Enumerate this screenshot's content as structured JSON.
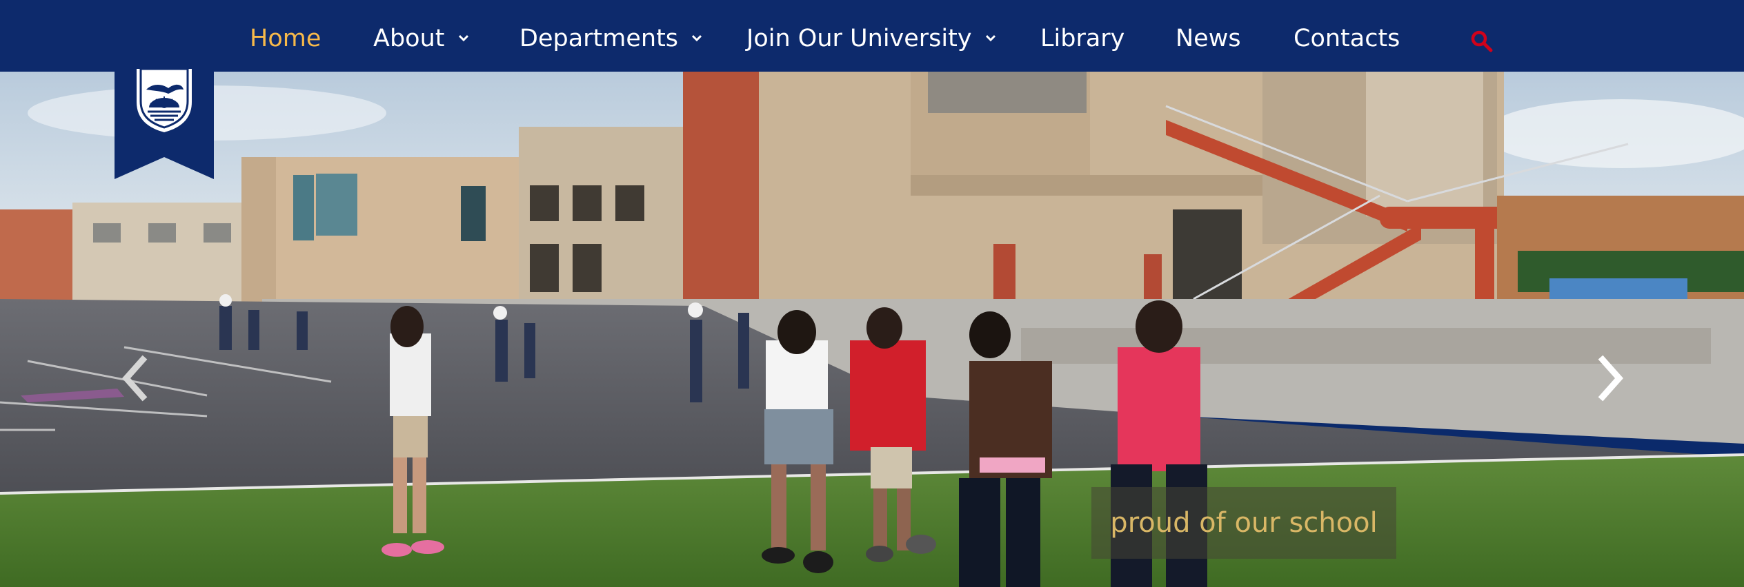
{
  "nav": {
    "items": [
      {
        "label": "Home",
        "active": true,
        "has_dropdown": false
      },
      {
        "label": "About",
        "active": false,
        "has_dropdown": true
      },
      {
        "label": "Departments",
        "active": false,
        "has_dropdown": true
      },
      {
        "label": "Join Our University",
        "active": false,
        "has_dropdown": true
      },
      {
        "label": "Library",
        "active": false,
        "has_dropdown": false
      },
      {
        "label": "News",
        "active": false,
        "has_dropdown": false
      },
      {
        "label": "Contacts",
        "active": false,
        "has_dropdown": false
      }
    ],
    "search_icon": "search-icon"
  },
  "colors": {
    "nav_background": "#0d2a6c",
    "nav_active": "#f6b94a",
    "nav_text": "#ffffff",
    "search_icon": "#d0021b",
    "caption_text": "#d9b766"
  },
  "hero": {
    "caption": "proud of our school",
    "prev_icon": "chevron-left-icon",
    "next_icon": "chevron-right-icon"
  },
  "crest": {
    "icon": "school-crest-icon"
  }
}
